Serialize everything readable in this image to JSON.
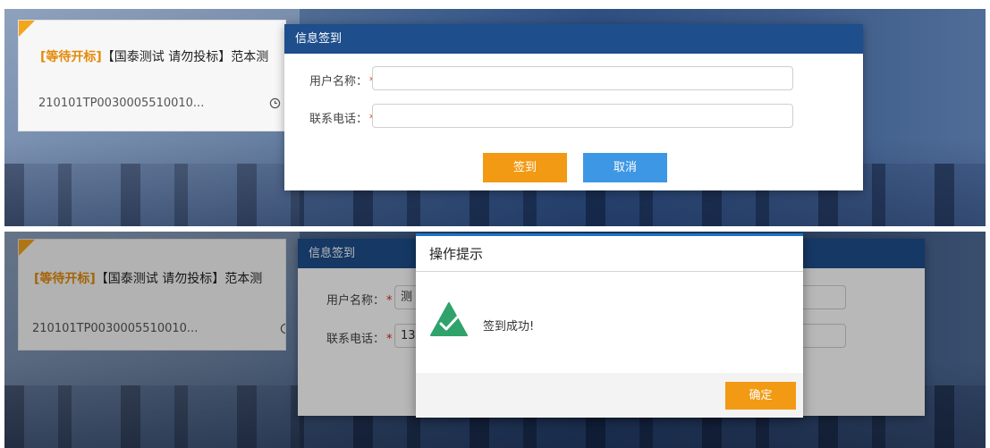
{
  "card": {
    "status": "[等待开标]",
    "title": "【国泰测试 请勿投标】范本测",
    "code": "210101TP0030005510010..."
  },
  "signin_dialog": {
    "title": "信息签到",
    "username_label": "用户名称：",
    "phone_label": "联系电话：",
    "required_mark": "*",
    "sign_button": "签到",
    "cancel_button": "取消"
  },
  "signin_dialog_filled": {
    "username_value": "测",
    "phone_value": "13"
  },
  "alert": {
    "title": "操作提示",
    "message": "签到成功!",
    "ok_button": "确定"
  },
  "colors": {
    "header_blue": "#1e4e8c",
    "status_orange": "#e48a06",
    "button_orange": "#f29a14",
    "button_blue": "#3d97e4",
    "success_green": "#2fa36b"
  },
  "icons": [
    "clock-icon",
    "success-check-icon"
  ]
}
